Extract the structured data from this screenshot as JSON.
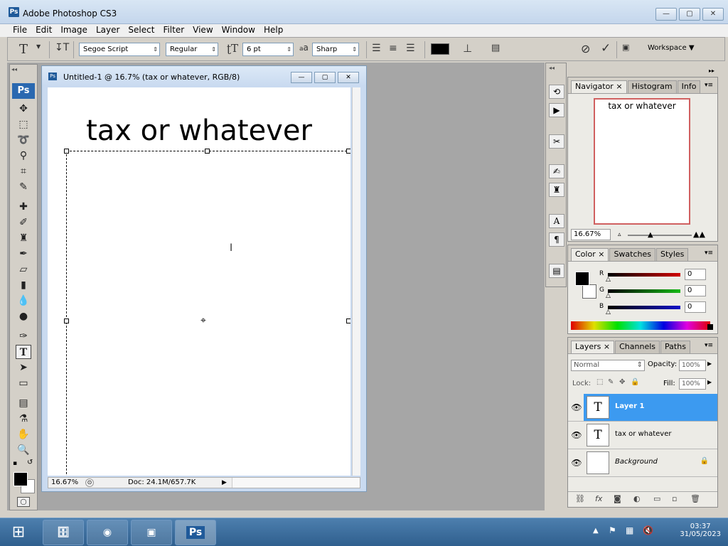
{
  "window": {
    "title": "Adobe Photoshop CS3",
    "logo": "Ps"
  },
  "menu": [
    "File",
    "Edit",
    "Image",
    "Layer",
    "Select",
    "Filter",
    "View",
    "Window",
    "Help"
  ],
  "options": {
    "font_family": "Segoe Script",
    "font_style": "Regular",
    "font_size": "6 pt",
    "aa_label": "a",
    "antialias": "Sharp",
    "workspace": "Workspace"
  },
  "document": {
    "title": "Untitled-1 @ 16.7% (tax or whatever, RGB/8)",
    "canvas_text": "tax or whatever",
    "zoom": "16.67%",
    "doc_info": "Doc: 24.1M/657.7K"
  },
  "tool_badge": "Ps",
  "navigator": {
    "tabs": [
      "Navigator",
      "Histogram",
      "Info"
    ],
    "preview_text": "tax or whatever",
    "zoom": "16.67%"
  },
  "color": {
    "tabs": [
      "Color",
      "Swatches",
      "Styles"
    ],
    "channels": [
      {
        "label": "R",
        "value": "0",
        "gradient_end": "#d10000"
      },
      {
        "label": "G",
        "value": "0",
        "gradient_end": "#16b916"
      },
      {
        "label": "B",
        "value": "0",
        "gradient_end": "#1010c8"
      }
    ]
  },
  "layers": {
    "tabs": [
      "Layers",
      "Channels",
      "Paths"
    ],
    "blend_mode": "Normal",
    "opacity_label": "Opacity:",
    "opacity": "100%",
    "lock_label": "Lock:",
    "fill_label": "Fill:",
    "fill": "100%",
    "items": [
      {
        "name": "Layer 1",
        "thumb": "T",
        "selected": true
      },
      {
        "name": "tax or whatever",
        "thumb": "T",
        "selected": false
      },
      {
        "name": "Background",
        "thumb": "",
        "selected": false
      }
    ]
  },
  "taskbar": {
    "time": "03:37",
    "date": "31/05/2023",
    "ps_label": "Ps"
  }
}
